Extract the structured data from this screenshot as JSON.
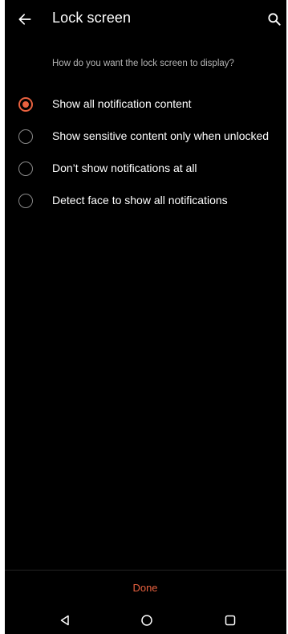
{
  "header": {
    "title": "Lock screen",
    "back_icon": "arrow-left-icon",
    "search_icon": "search-icon"
  },
  "prompt": "How do you want the lock screen to display?",
  "options": [
    {
      "label": "Show all notification content",
      "selected": true
    },
    {
      "label": "Show sensitive content only when unlocked",
      "selected": false
    },
    {
      "label": "Don’t show notifications at all",
      "selected": false
    },
    {
      "label": "Detect face to show all notifications",
      "selected": false
    }
  ],
  "footer": {
    "done_label": "Done"
  },
  "nav": {
    "back_icon": "triangle-back-icon",
    "home_icon": "circle-home-icon",
    "recents_icon": "square-recents-icon"
  },
  "colors": {
    "accent": "#e8613f",
    "background": "#000000",
    "text_primary": "#ffffff",
    "text_secondary": "#b3b3b3"
  }
}
